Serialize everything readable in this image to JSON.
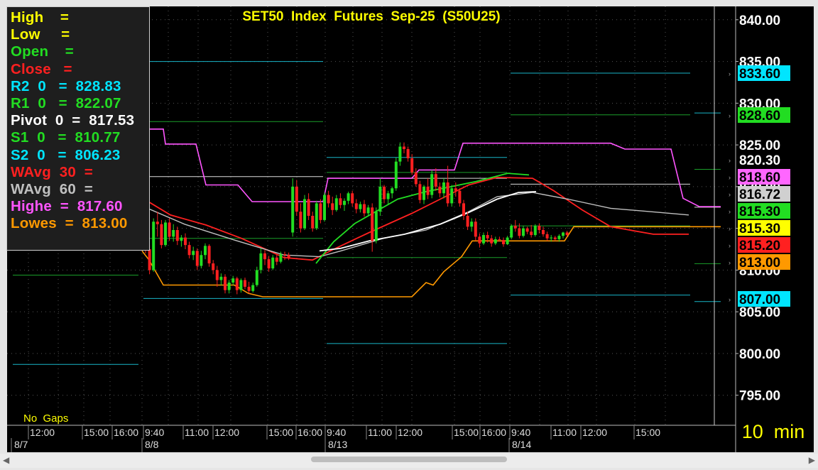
{
  "chart_data": {
    "type": "candlestick",
    "title": "SET50  Index  Futures  Sep-25  (S50U25)",
    "interval_label": "10  min",
    "gaps_label": "No  Gaps",
    "y_range": [
      791.4,
      841.6
    ],
    "y_ticks": [
      {
        "value": 840,
        "label": "840.00"
      },
      {
        "value": 835,
        "label": "835.00"
      },
      {
        "value": 830,
        "label": "830.00"
      },
      {
        "value": 825,
        "label": "825.00"
      },
      {
        "value": 820,
        "label": "820.00"
      },
      {
        "value": 815,
        "label": "815.00"
      },
      {
        "value": 810,
        "label": "810.00"
      },
      {
        "value": 805,
        "label": "805.00"
      },
      {
        "value": 800,
        "label": "800.00"
      },
      {
        "value": 795,
        "label": "795.00"
      }
    ],
    "x_time_labels": [
      "12:00",
      "15:00",
      "16:00",
      "9:40",
      "11:00",
      "12:00",
      "15:00",
      "16:00",
      "9:40",
      "11:00",
      "12:00",
      "15:00",
      "16:00",
      "9:40",
      "11:00",
      "12:00",
      "15:00"
    ],
    "x_date_labels": [
      "8/7",
      "8/8",
      "8/13",
      "8/14"
    ],
    "price_tags": [
      {
        "value": 833.6,
        "label": "833.60",
        "bg": "#00e5ff",
        "fg": "#000000"
      },
      {
        "value": 828.6,
        "label": "828.60",
        "bg": "#22dd22",
        "fg": "#000000"
      },
      {
        "value": 820.3,
        "label": "820.30",
        "bg": "#000000",
        "fg": "#ffffff"
      },
      {
        "value": 818.6,
        "label": "818.60",
        "bg": "#ff66ff",
        "fg": "#000000"
      },
      {
        "value": 816.72,
        "label": "816.72",
        "bg": "#d0d0d0",
        "fg": "#000000"
      },
      {
        "value": 815.3,
        "label": "815.30",
        "bg": "#22dd22",
        "fg": "#000000"
      },
      {
        "value": 815.3,
        "label": "815.30",
        "bg": "#ffff00",
        "fg": "#000000"
      },
      {
        "value": 815.2,
        "label": "815.20",
        "bg": "#ff2020",
        "fg": "#000000"
      },
      {
        "value": 813.0,
        "label": "813.00",
        "bg": "#ff9900",
        "fg": "#000000"
      },
      {
        "value": 807.0,
        "label": "807.00",
        "bg": "#00e5ff",
        "fg": "#000000"
      }
    ],
    "pivot_levels": [
      {
        "session": "8/7",
        "r2": 838.5,
        "r1": 827.9,
        "pivot": 821.5,
        "s1": 809.4,
        "s2": 798.7
      },
      {
        "session": "8/8",
        "r2": 835.0,
        "r1": 827.8,
        "pivot": 821.2,
        "s1": 813.8,
        "s2": 806.6
      },
      {
        "session": "8/13",
        "r2": 823.5,
        "r1": 821.7,
        "pivot": 821.0,
        "s1": 811.5,
        "s2": 801.2
      },
      {
        "session": "8/14",
        "r2": 833.6,
        "r1": 828.6,
        "pivot": 820.3,
        "s1": 815.3,
        "s2": 807.0
      },
      {
        "session": "next",
        "r2": 828.83,
        "r1": 822.07,
        "pivot": 817.53,
        "s1": 810.77,
        "s2": 806.23
      }
    ],
    "series": [
      {
        "name": "WAvg 30",
        "color": "#ff2020"
      },
      {
        "name": "WAvg 60",
        "color": "#c0c0c0"
      },
      {
        "name": "Highe",
        "color": "#ff55ff"
      },
      {
        "name": "Lowes",
        "color": "#ff9900"
      },
      {
        "name": "",
        "color": "#22dd22"
      },
      {
        "name": "",
        "color": "#ffffff"
      }
    ],
    "candles_start_x": 205,
    "candles_step_x": 5.6,
    "candles": [
      [
        815,
        815.5,
        812,
        812.5
      ],
      [
        812.5,
        813,
        809.5,
        810
      ],
      [
        810,
        816.2,
        809.8,
        815.8
      ],
      [
        815.8,
        817,
        814,
        815.5
      ],
      [
        815.5,
        816,
        812.6,
        813
      ],
      [
        813,
        816,
        812.8,
        815.7
      ],
      [
        815.7,
        816.2,
        813.5,
        814
      ],
      [
        814,
        815.5,
        813.4,
        814.8
      ],
      [
        814.8,
        815.2,
        813,
        813.5
      ],
      [
        813.5,
        814.2,
        812.8,
        813.9
      ],
      [
        813.9,
        814.4,
        812.5,
        813
      ],
      [
        813,
        813.4,
        811.4,
        811.8
      ],
      [
        811.8,
        812.8,
        811.2,
        812.3
      ],
      [
        812.3,
        812.6,
        810,
        810.5
      ],
      [
        810.5,
        812.3,
        810.2,
        811.8
      ],
      [
        811.8,
        813.2,
        811.3,
        812.9
      ],
      [
        812.9,
        813.1,
        810.4,
        810.8
      ],
      [
        810.8,
        811.2,
        809.5,
        810
      ],
      [
        810,
        810.5,
        808,
        808.8
      ],
      [
        808.8,
        809.6,
        808.2,
        809.2
      ],
      [
        809.2,
        809.5,
        807.2,
        807.6
      ],
      [
        807.6,
        808.8,
        807.2,
        808.5
      ],
      [
        808.5,
        809.3,
        808.2,
        809
      ],
      [
        809,
        809.2,
        807.1,
        807.6
      ],
      [
        807.6,
        809,
        807.3,
        808.8
      ],
      [
        808.8,
        809.1,
        807.7,
        808
      ],
      [
        808,
        808.6,
        807.2,
        807.5
      ],
      [
        807.5,
        808.5,
        807.3,
        808.2
      ],
      [
        808.2,
        810.4,
        808,
        810
      ],
      [
        810,
        812.6,
        809.6,
        812
      ],
      [
        812,
        812.4,
        810.6,
        811.3
      ],
      [
        811.3,
        811.7,
        809.8,
        810.2
      ],
      [
        810.2,
        811.8,
        810,
        811.5
      ],
      [
        811.5,
        811.9,
        810.6,
        811
      ],
      [
        811,
        812.2,
        810.8,
        811.9
      ],
      [
        811.9,
        812.2,
        811.2,
        811.8
      ],
      [
        811.8,
        812.1,
        811.2,
        811.5
      ],
      [
        814.5,
        821,
        814,
        820
      ],
      [
        820,
        820.8,
        816.5,
        817
      ],
      [
        817,
        818,
        814.5,
        815
      ],
      [
        815,
        819,
        814.8,
        818.5
      ],
      [
        818.5,
        819.2,
        816,
        816.5
      ],
      [
        816.5,
        817,
        814.6,
        815
      ],
      [
        815,
        818.3,
        814.8,
        818
      ],
      [
        818,
        818.5,
        815.6,
        816
      ],
      [
        816,
        819.3,
        815.8,
        819
      ],
      [
        819,
        819.5,
        817.5,
        818
      ],
      [
        818,
        818.8,
        816.6,
        817.2
      ],
      [
        817.2,
        819,
        817,
        818.6
      ],
      [
        818.6,
        819.2,
        817.4,
        817.8
      ],
      [
        817.8,
        818.6,
        817.1,
        818.3
      ],
      [
        818.3,
        819.4,
        817.9,
        819.2
      ],
      [
        819.2,
        819.5,
        817.6,
        818
      ],
      [
        818,
        818.5,
        816.8,
        817.3
      ],
      [
        817.3,
        818.2,
        816.9,
        817.9
      ],
      [
        817.9,
        818.4,
        816.4,
        816.8
      ],
      [
        816.8,
        817.8,
        816.5,
        817.5
      ],
      [
        817.5,
        818,
        812.2,
        813.5
      ],
      [
        813.5,
        817.5,
        813.2,
        817
      ],
      [
        817,
        821,
        816.5,
        820
      ],
      [
        820,
        820.2,
        818,
        818.5
      ],
      [
        818.5,
        819.5,
        817.8,
        819.2
      ],
      [
        819.2,
        820,
        818.6,
        819.8
      ],
      [
        819.8,
        823.5,
        819.5,
        823
      ],
      [
        823,
        825.3,
        822.5,
        824.8
      ],
      [
        824.8,
        825.3,
        824,
        824.5
      ],
      [
        824.5,
        824.8,
        823,
        823.4
      ],
      [
        823.4,
        823.9,
        821.4,
        821.7
      ],
      [
        821.7,
        822.2,
        820,
        820.3
      ],
      [
        820.3,
        820.7,
        818,
        818.4
      ],
      [
        818.4,
        820.2,
        817.9,
        820
      ],
      [
        820,
        821,
        818.5,
        819
      ],
      [
        819,
        822,
        818.6,
        821.5
      ],
      [
        821.5,
        822.2,
        819.5,
        820
      ],
      [
        820,
        820.5,
        818.7,
        819.2
      ],
      [
        819.2,
        821,
        818.6,
        820.5
      ],
      [
        820.5,
        822.5,
        817.6,
        818
      ],
      [
        818,
        820.2,
        817.6,
        819.8
      ],
      [
        819.8,
        820.5,
        818.8,
        819.5
      ],
      [
        819.5,
        819.8,
        817.6,
        818
      ],
      [
        818,
        818.4,
        816,
        816.5
      ],
      [
        816.5,
        817,
        814.8,
        815.2
      ],
      [
        815.2,
        816.2,
        814.6,
        815.8
      ],
      [
        815.8,
        816.2,
        813.5,
        814
      ],
      [
        814,
        814.4,
        812.7,
        813.2
      ],
      [
        813.2,
        814.5,
        813,
        814.2
      ],
      [
        814.2,
        814.6,
        813.3,
        813.8
      ],
      [
        813.8,
        814.2,
        812.8,
        813.2
      ],
      [
        813.2,
        814,
        813,
        813.7
      ],
      [
        813.7,
        814,
        813.4,
        813.6
      ],
      [
        813.6,
        813.9,
        812.8,
        813.1
      ],
      [
        813.1,
        814.1,
        813,
        813.9
      ],
      [
        813.9,
        815.5,
        813.7,
        815.3
      ],
      [
        815.3,
        816,
        814.6,
        815
      ],
      [
        815,
        815.6,
        813.8,
        814.1
      ],
      [
        814.1,
        815.3,
        813.9,
        815
      ],
      [
        815,
        815.2,
        814.3,
        814.6
      ],
      [
        814.6,
        815.4,
        813.9,
        814.2
      ],
      [
        814.2,
        815.5,
        814,
        815.3
      ],
      [
        815.3,
        815.6,
        814.4,
        814.8
      ],
      [
        814.8,
        815.2,
        814,
        814.3
      ],
      [
        814.3,
        814.6,
        813.5,
        813.8
      ],
      [
        813.8,
        814.2,
        813.4,
        813.9
      ],
      [
        813.9,
        814.1,
        813.5,
        813.7
      ],
      [
        813.7,
        814.3,
        813.4,
        814.1
      ],
      [
        814.1,
        814.6,
        813.8,
        814.5
      ],
      [
        814.5,
        814.7,
        814,
        814.2
      ]
    ]
  },
  "info_panel": {
    "lines": [
      {
        "text": "High    =",
        "color": "#ffff00"
      },
      {
        "text": "Low     =",
        "color": "#ffff00"
      },
      {
        "text": "Open    =",
        "color": "#22dd22"
      },
      {
        "text": "Close   =",
        "color": "#ff2020"
      },
      {
        "text": "R2  0   =  828.83",
        "color": "#00e5ff"
      },
      {
        "text": "R1  0   =  822.07",
        "color": "#22dd22"
      },
      {
        "text": "Pivot  0  =  817.53",
        "color": "#ffffff"
      },
      {
        "text": "S1  0   =  810.77",
        "color": "#22dd22"
      },
      {
        "text": "S2  0   =  806.23",
        "color": "#00e5ff"
      },
      {
        "text": "WAvg  30  =",
        "color": "#ff2020"
      },
      {
        "text": "WAvg  60  =",
        "color": "#c0c0c0"
      },
      {
        "text": "Highe  =  817.60",
        "color": "#ff55ff"
      },
      {
        "text": "Lowes  =  813.00",
        "color": "#ff9900"
      }
    ]
  },
  "scrollbar": {
    "left_arrow": "◀",
    "right_arrow": "▶"
  }
}
